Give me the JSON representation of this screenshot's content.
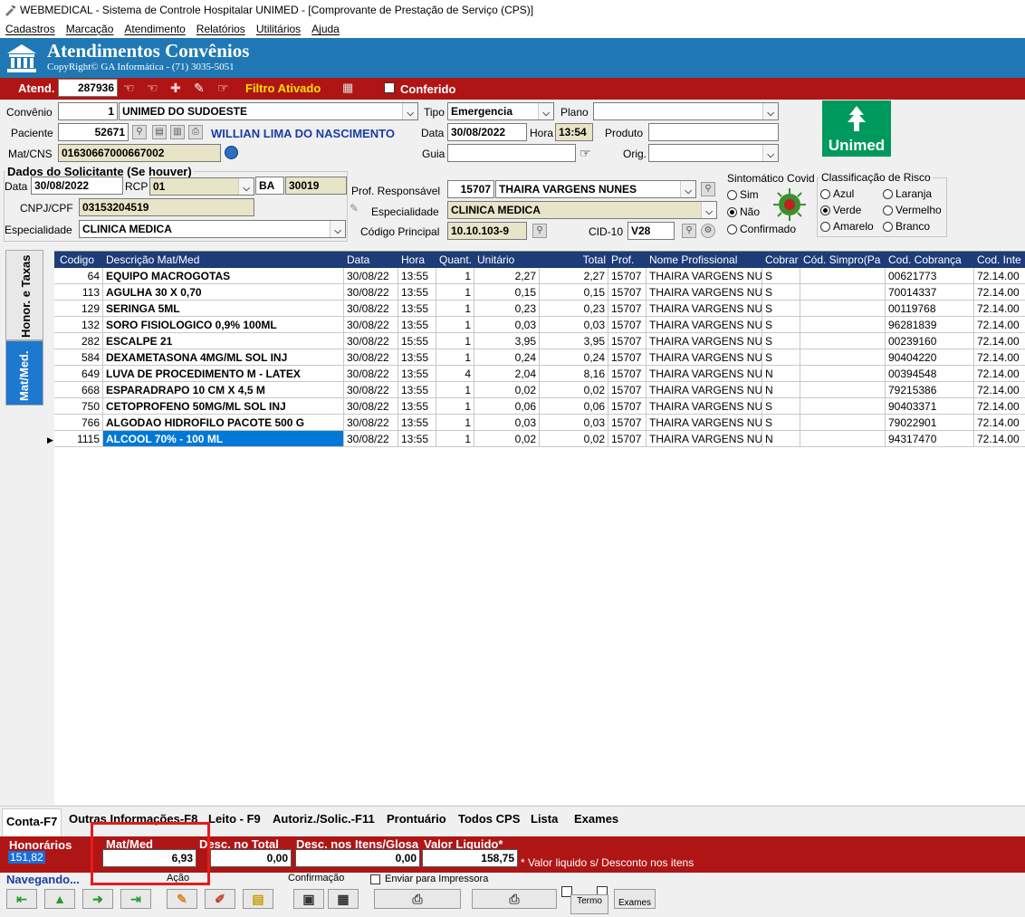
{
  "window": {
    "title": "WEBMEDICAL - Sistema de Controle Hospitalar UNIMED - [Comprovante de Prestação de Serviço  (CPS)]"
  },
  "menu": [
    "Cadastros",
    "Marcação",
    "Atendimento",
    "Relatórios",
    "Utilitários",
    "Ajuda"
  ],
  "banner": {
    "title": "Atendimentos Convênios",
    "copyright": "CopyRight© GA Informática - (71) 3035-5051"
  },
  "atend": {
    "label": "Atend.",
    "value": "287936",
    "filter": "Filtro Ativado",
    "conferido": "Conferido"
  },
  "form": {
    "convenio_label": "Convênio",
    "convenio_code": "1",
    "convenio_name": "UNIMED DO SUDOESTE",
    "tipo_label": "Tipo",
    "tipo_value": "Emergencia",
    "plano_label": "Plano",
    "plano_value": "",
    "paciente_label": "Paciente",
    "paciente_code": "52671",
    "paciente_name": "WILLIAN LIMA DO NASCIMENTO",
    "data_label": "Data",
    "data_value": "30/08/2022",
    "hora_label": "Hora",
    "hora_value": "13:54",
    "produto_label": "Produto",
    "produto_value": "",
    "matcns_label": "Mat/CNS",
    "matcns_value": "01630667000667002",
    "guia_label": "Guia",
    "guia_value": "",
    "orig_label": "Orig.",
    "orig_value": ""
  },
  "solicitante": {
    "title": "Dados do Solicitante (Se houver)",
    "data_label": "Data",
    "data_value": "30/08/2022",
    "rcp_label": "RCP",
    "rcp_value": "01",
    "uf": "BA",
    "rcp_num": "30019",
    "cnpj_label": "CNPJ/CPF",
    "cnpj_value": "03153204519",
    "esp_label": "Especialidade",
    "esp_value": "CLINICA MEDICA"
  },
  "prof": {
    "label": "Prof. Responsável",
    "code": "15707",
    "name": "THAIRA VARGENS NUNES",
    "esp_label": "Especialidade",
    "esp_value": "CLINICA MEDICA",
    "cod_label": "Código Principal",
    "cod_value": "10.10.103-9",
    "cid_label": "CID-10",
    "cid_value": "V28"
  },
  "covid": {
    "title": "Sintomático Covid",
    "options": [
      "Sim",
      "Não",
      "Confirmado"
    ],
    "selected": "Não"
  },
  "risco": {
    "title": "Classificação de Risco",
    "options": [
      "Azul",
      "Laranja",
      "Verde",
      "Vermelho",
      "Amarelo",
      "Branco"
    ],
    "selected": "Verde"
  },
  "unimed_logo": "Unimed",
  "side_tabs": [
    "Honor. e Taxas",
    "Mat/Med."
  ],
  "grid": {
    "columns": [
      "Codigo",
      "Descrição Mat/Med",
      "Data",
      "Hora",
      "Quant.",
      "Unitário",
      "Total",
      "Prof.",
      "Nome Profissional",
      "Cobrar",
      "Cód. Simpro(Pa",
      "Cod. Cobrança",
      "Cod. Inte"
    ],
    "rows": [
      [
        "64",
        "EQUIPO MACROGOTAS",
        "30/08/22",
        "13:55",
        "1",
        "2,27",
        "2,27",
        "15707",
        "THAIRA VARGENS NU",
        "S",
        "",
        "00621773",
        "72.14.00"
      ],
      [
        "113",
        "AGULHA 30 X 0,70",
        "30/08/22",
        "13:55",
        "1",
        "0,15",
        "0,15",
        "15707",
        "THAIRA VARGENS NU",
        "S",
        "",
        "70014337",
        "72.14.00"
      ],
      [
        "129",
        "SERINGA 5ML",
        "30/08/22",
        "13:55",
        "1",
        "0,23",
        "0,23",
        "15707",
        "THAIRA VARGENS NU",
        "S",
        "",
        "00119768",
        "72.14.00"
      ],
      [
        "132",
        "SORO FISIOLOGICO 0,9% 100ML",
        "30/08/22",
        "13:55",
        "1",
        "0,03",
        "0,03",
        "15707",
        "THAIRA VARGENS NU",
        "S",
        "",
        "96281839",
        "72.14.00"
      ],
      [
        "282",
        "ESCALPE 21",
        "30/08/22",
        "15:55",
        "1",
        "3,95",
        "3,95",
        "15707",
        "THAIRA VARGENS NU",
        "S",
        "",
        "00239160",
        "72.14.00"
      ],
      [
        "584",
        "DEXAMETASONA 4MG/ML SOL INJ",
        "30/08/22",
        "13:55",
        "1",
        "0,24",
        "0,24",
        "15707",
        "THAIRA VARGENS NU",
        "S",
        "",
        "90404220",
        "72.14.00"
      ],
      [
        "649",
        "LUVA DE PROCEDIMENTO M - LATEX",
        "30/08/22",
        "13:55",
        "4",
        "2,04",
        "8,16",
        "15707",
        "THAIRA VARGENS NU",
        "N",
        "",
        "00394548",
        "72.14.00"
      ],
      [
        "668",
        "ESPARADRAPO 10 CM X 4,5 M",
        "30/08/22",
        "13:55",
        "1",
        "0,02",
        "0,02",
        "15707",
        "THAIRA VARGENS NU",
        "N",
        "",
        "79215386",
        "72.14.00"
      ],
      [
        "750",
        "CETOPROFENO 50MG/ML SOL INJ",
        "30/08/22",
        "13:55",
        "1",
        "0,06",
        "0,06",
        "15707",
        "THAIRA VARGENS NU",
        "S",
        "",
        "90403371",
        "72.14.00"
      ],
      [
        "766",
        "ALGODAO HIDROFILO PACOTE 500 G",
        "30/08/22",
        "13:55",
        "1",
        "0,03",
        "0,03",
        "15707",
        "THAIRA VARGENS NU",
        "S",
        "",
        "79022901",
        "72.14.00"
      ],
      [
        "1115",
        "ALCOOL 70% - 100 ML",
        "30/08/22",
        "13:55",
        "1",
        "0,02",
        "0,02",
        "15707",
        "THAIRA VARGENS NU",
        "N",
        "",
        "94317470",
        "72.14.00"
      ]
    ]
  },
  "bottom_tabs": [
    "Conta-F7",
    "Outras Informações-F8",
    "Leito - F9",
    "Autoriz./Solic.-F11",
    "Prontuário",
    "Todos CPS",
    "Lista",
    "Exames"
  ],
  "totals": {
    "honorarios_label": "Honorários",
    "honorarios_value": "151,82",
    "matmed_label": "Mat/Med",
    "matmed_value": "6,93",
    "desc_total_label": "Desc. no Total",
    "desc_total_value": "0,00",
    "desc_itens_label": "Desc. nos Itens/Glosa",
    "desc_itens_value": "0,00",
    "liquido_label": "Valor Liquido*",
    "liquido_value": "158,75",
    "note": "* Valor liquido s/ Desconto nos itens"
  },
  "nav": {
    "status": "Navegando...",
    "acao": "Ação",
    "confirmacao": "Confirmação",
    "enviar": "Enviar para Impressora",
    "termo": "Termo",
    "exames": "Exames"
  }
}
